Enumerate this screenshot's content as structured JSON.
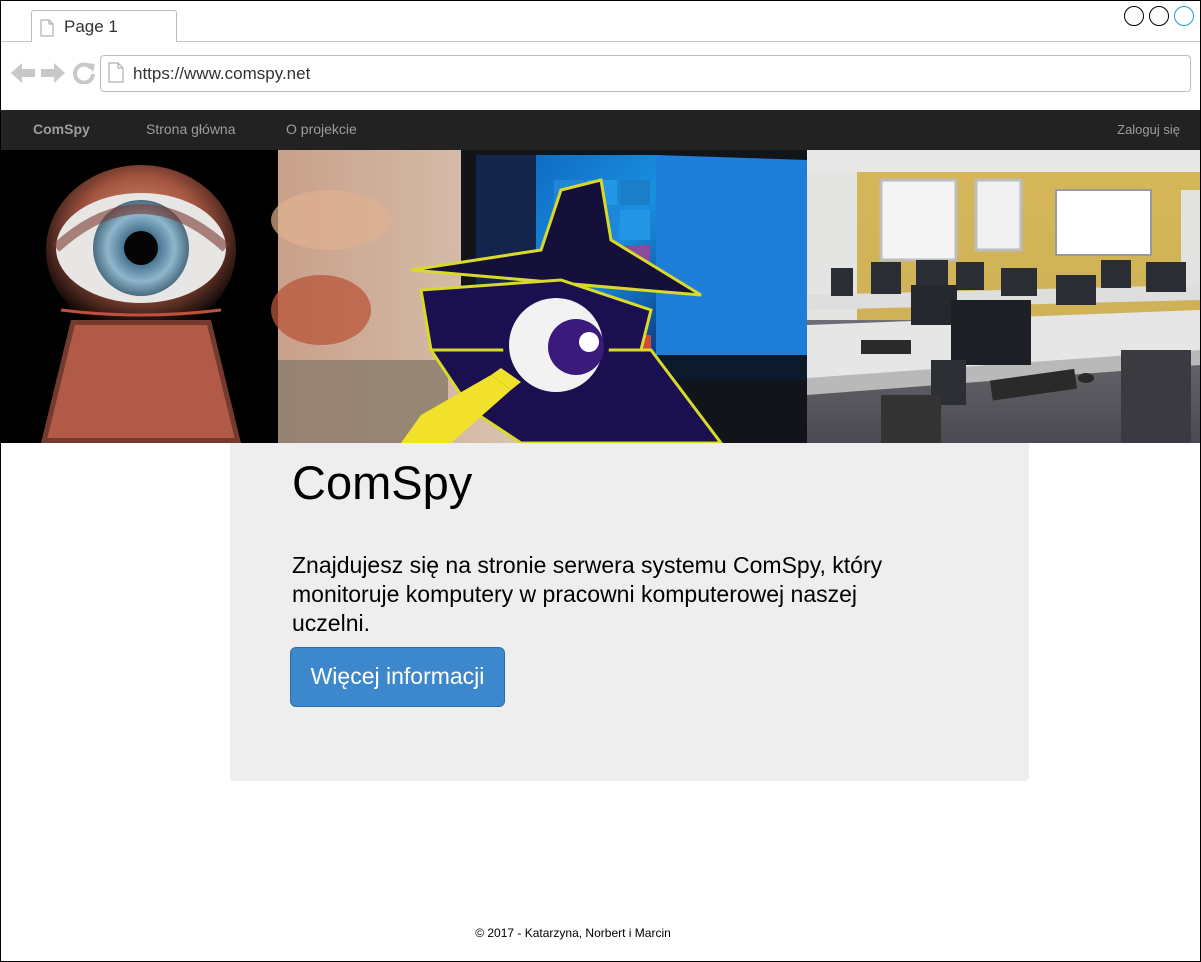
{
  "browser": {
    "tab_title": "Page 1",
    "url": "https://www.comspy.net"
  },
  "navbar": {
    "brand": "ComSpy",
    "links": [
      "Strona główna",
      "O projekcie"
    ],
    "login": "Zaloguj się"
  },
  "hero": {
    "images": [
      "eye-through-keyhole-photo",
      "spy-cartoon-windows-screen-photo",
      "computer-lab-classroom-photo"
    ]
  },
  "jumbotron": {
    "title": "ComSpy",
    "text": "Znajdujesz się na stronie serwera systemu ComSpy, który monitoruje komputery w pracowni komputerowej naszej uczelni.",
    "button": "Więcej informacji"
  },
  "footer": {
    "text": "© 2017 - Katarzyna, Norbert i Marcin"
  },
  "colors": {
    "navbar_bg": "#222222",
    "navbar_text": "#9d9d9d",
    "jumbotron_bg": "#eeeeee",
    "button_bg": "#3d88cc"
  }
}
